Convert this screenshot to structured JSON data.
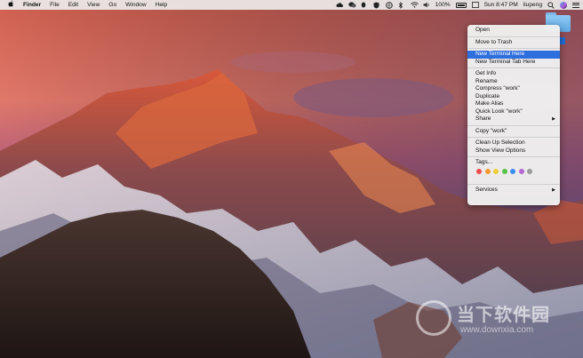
{
  "menubar": {
    "apple": "",
    "app_name": "Finder",
    "menus": [
      "File",
      "Edit",
      "View",
      "Go",
      "Window",
      "Help"
    ],
    "battery_text": "100%",
    "clock": "Sun 8:47 PM",
    "user": "liupeng"
  },
  "desktop": {
    "folder_name": "work"
  },
  "context_menu": {
    "sections": [
      {
        "items": [
          {
            "label": "Open"
          }
        ]
      },
      {
        "items": [
          {
            "label": "Move to Trash"
          }
        ]
      },
      {
        "items": [
          {
            "label": "New Terminal Here",
            "highlighted": true
          },
          {
            "label": "New Terminal Tab Here"
          }
        ]
      },
      {
        "items": [
          {
            "label": "Get Info"
          },
          {
            "label": "Rename"
          },
          {
            "label": "Compress \"work\""
          },
          {
            "label": "Duplicate"
          },
          {
            "label": "Make Alias"
          },
          {
            "label": "Quick Look \"work\""
          },
          {
            "label": "Share",
            "submenu": true
          }
        ]
      },
      {
        "items": [
          {
            "label": "Copy \"work\""
          }
        ]
      },
      {
        "items": [
          {
            "label": "Clean Up Selection"
          },
          {
            "label": "Show View Options"
          }
        ]
      },
      {
        "items": [
          {
            "label": "Tags..."
          }
        ]
      },
      {
        "items": [
          {
            "label": "Services",
            "submenu": true
          }
        ]
      }
    ],
    "tag_colors": [
      "#ef4b4b",
      "#f59b2e",
      "#f3cf33",
      "#56c348",
      "#3b8ef0",
      "#b568d6",
      "#9a9a9a"
    ],
    "accent": "#2e6fde"
  },
  "watermark": {
    "chinese": "当下软件园",
    "url": "www.downxia.com"
  }
}
